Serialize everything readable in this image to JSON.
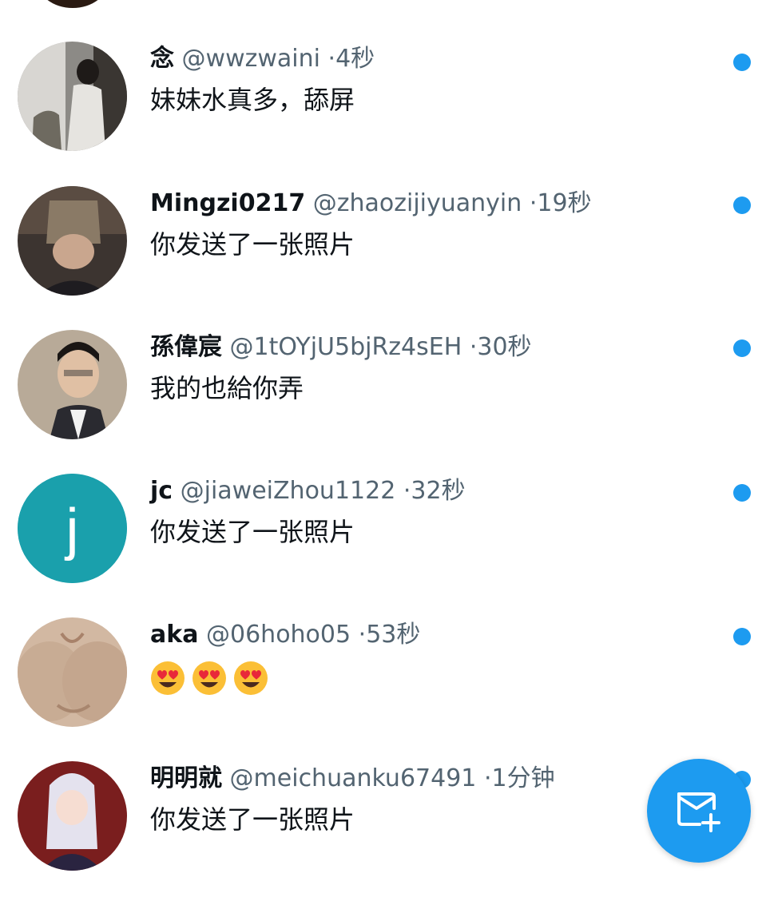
{
  "colors": {
    "accent": "#1d9bf0",
    "text_primary": "#0f1419",
    "text_secondary": "#536471"
  },
  "conversations": [
    {
      "name": "念",
      "handle": "@wwzwaini",
      "separator": "·",
      "time": "4秒",
      "message": "妹妹水真多，舔屏",
      "unread": true,
      "avatar": "photo-avatar"
    },
    {
      "name": "Mingzi0217",
      "handle": "@zhaozijiyuanyin",
      "separator": "·",
      "time": "19秒",
      "message": "你发送了一张照片",
      "unread": true,
      "avatar": "photo-avatar"
    },
    {
      "name": "孫偉宸",
      "handle": "@1tOYjU5bjRz4sEH",
      "separator": "·",
      "time": "30秒",
      "message": "我的也給你弄",
      "unread": true,
      "avatar": "photo-avatar"
    },
    {
      "name": "jc",
      "handle": "@jiaweiZhou1122",
      "separator": "·",
      "time": "32秒",
      "message": "你发送了一张照片",
      "unread": true,
      "avatar": "letter-avatar",
      "avatar_letter": "j",
      "avatar_color": "#1aa0ac"
    },
    {
      "name": "aka",
      "handle": "@06hoho05",
      "separator": "·",
      "time": "53秒",
      "message": "",
      "message_emojis": [
        "heart-eyes-emoji",
        "heart-eyes-emoji",
        "heart-eyes-emoji"
      ],
      "unread": true,
      "avatar": "photo-avatar"
    },
    {
      "name": "明明就",
      "handle": "@meichuanku67491",
      "separator": "·",
      "time": "1分钟",
      "message": "你发送了一张照片",
      "unread": true,
      "avatar": "photo-avatar"
    }
  ],
  "fab": {
    "icon": "new-message-icon"
  }
}
